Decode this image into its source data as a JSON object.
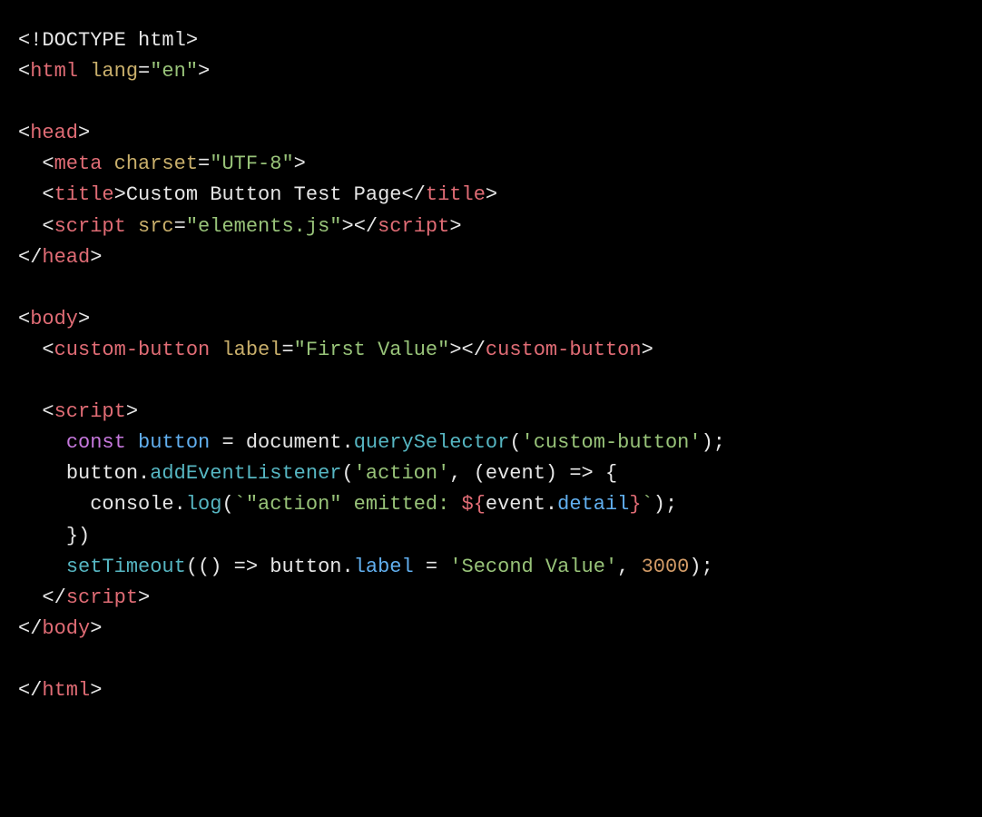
{
  "code": {
    "l1": {
      "doctype_open": "<!",
      "doctype_kw": "DOCTYPE",
      "space": " ",
      "doctype_root": "html",
      "close": ">"
    },
    "l2": {
      "open": "<",
      "tag": "html",
      "sp": " ",
      "attr": "lang",
      "eq": "=",
      "val": "\"en\"",
      "close": ">"
    },
    "l4": {
      "open": "<",
      "tag": "head",
      "close": ">"
    },
    "l5": {
      "open": "<",
      "tag": "meta",
      "sp": " ",
      "attr": "charset",
      "eq": "=",
      "val": "\"UTF-8\"",
      "close": ">"
    },
    "l6": {
      "open": "<",
      "tag": "title",
      "close": ">",
      "text": "Custom Button Test Page",
      "open2": "</",
      "tag2": "title",
      "close2": ">"
    },
    "l7": {
      "open": "<",
      "tag": "script",
      "sp": " ",
      "attr": "src",
      "eq": "=",
      "val": "\"elements.js\"",
      "close": ">",
      "open2": "</",
      "tag2": "script",
      "close2": ">"
    },
    "l8": {
      "open": "</",
      "tag": "head",
      "close": ">"
    },
    "l10": {
      "open": "<",
      "tag": "body",
      "close": ">"
    },
    "l11": {
      "open": "<",
      "tag": "custom-button",
      "sp": " ",
      "attr": "label",
      "eq": "=",
      "val": "\"First Value\"",
      "close": ">",
      "open2": "</",
      "tag2": "custom-button",
      "close2": ">"
    },
    "l13": {
      "open": "<",
      "tag": "script",
      "close": ">"
    },
    "l14": {
      "kw": "const",
      "sp1": " ",
      "var": "button",
      "sp2": " ",
      "eq": "=",
      "sp3": " ",
      "obj": "document",
      "dot": ".",
      "fn": "querySelector",
      "po": "(",
      "str": "'custom-button'",
      "pc": ")",
      "semi": ";"
    },
    "l15": {
      "obj": "button",
      "dot": ".",
      "fn": "addEventListener",
      "po": "(",
      "str": "'action'",
      "comma": ", ",
      "po2": "(",
      "param": "event",
      "pc2": ")",
      "arrow": " => ",
      "brace": "{"
    },
    "l16": {
      "obj": "console",
      "dot": ".",
      "fn": "log",
      "po": "(",
      "bt1": "`",
      "s1": "\"action\" emitted: ",
      "io": "${",
      "pobj": "event",
      "pdot": ".",
      "pprop": "detail",
      "ic": "}",
      "bt2": "`",
      "pc": ")",
      "semi": ";"
    },
    "l17": {
      "brace": "})"
    },
    "l18": {
      "fn": "setTimeout",
      "po": "(",
      "po2": "(",
      "pc2": ")",
      "arrow": " => ",
      "obj": "button",
      "dot": ".",
      "prop": "label",
      "sp": " ",
      "eq": "=",
      "sp2": " ",
      "str": "'Second Value'",
      "comma": ", ",
      "num": "3000",
      "pc": ")",
      "semi": ";"
    },
    "l19": {
      "open": "</",
      "tag": "script",
      "close": ">"
    },
    "l20": {
      "open": "</",
      "tag": "body",
      "close": ">"
    },
    "l22": {
      "open": "</",
      "tag": "html",
      "close": ">"
    }
  }
}
